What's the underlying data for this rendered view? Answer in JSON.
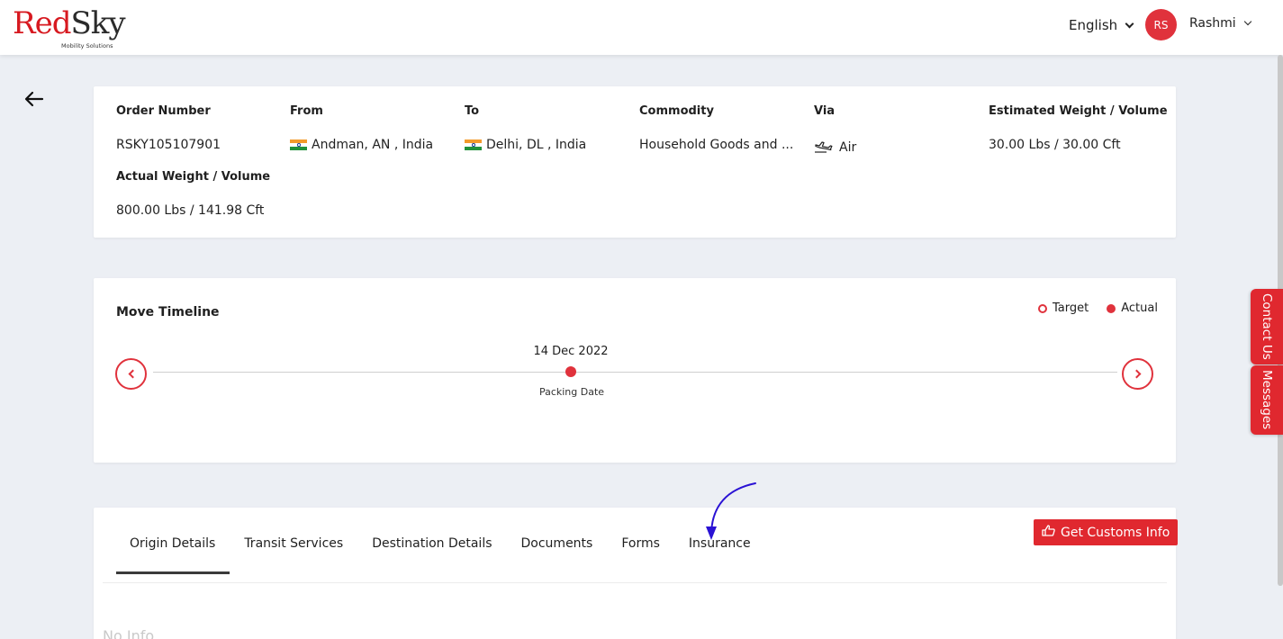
{
  "header": {
    "logo": {
      "word_red": "Red",
      "word_dark": "Sky",
      "tagline": "Mobility Solutions"
    },
    "language": "English",
    "avatar_initials": "RS",
    "user_name": "Rashmi"
  },
  "order": {
    "fields": [
      {
        "label": "Order Number",
        "value": "RSKY105107901"
      },
      {
        "label": "From",
        "value": "Andman, AN , India"
      },
      {
        "label": "To",
        "value": "Delhi, DL , India"
      },
      {
        "label": "Commodity",
        "value": "Household Goods and ..."
      },
      {
        "label": "Via",
        "value": "Air"
      },
      {
        "label": "Estimated Weight / Volume",
        "value": "30.00 Lbs / 30.00 Cft"
      },
      {
        "label": "Actual Weight / Volume",
        "value": "800.00 Lbs / 141.98 Cft"
      }
    ]
  },
  "timeline": {
    "title": "Move Timeline",
    "legend_target": "Target",
    "legend_actual": "Actual",
    "event_date": "14 Dec 2022",
    "event_label": "Packing Date"
  },
  "details": {
    "tabs": [
      {
        "label": "Origin Details",
        "active": true
      },
      {
        "label": "Transit Services"
      },
      {
        "label": "Destination Details"
      },
      {
        "label": "Documents"
      },
      {
        "label": "Forms"
      },
      {
        "label": "Insurance"
      }
    ],
    "customs_button": "Get Customs Info",
    "empty_text": "No Info"
  },
  "side_tabs": {
    "contact": "Contact Us",
    "messages": "Messages"
  },
  "colors": {
    "brand_red": "#e0282f",
    "annotation_arrow": "#2a12d4"
  },
  "icons": [
    "back-arrow-icon",
    "chevron-down-icon",
    "india-flag-icon",
    "airplane-icon",
    "chevron-left-icon",
    "chevron-right-icon",
    "thumbs-up-icon"
  ]
}
